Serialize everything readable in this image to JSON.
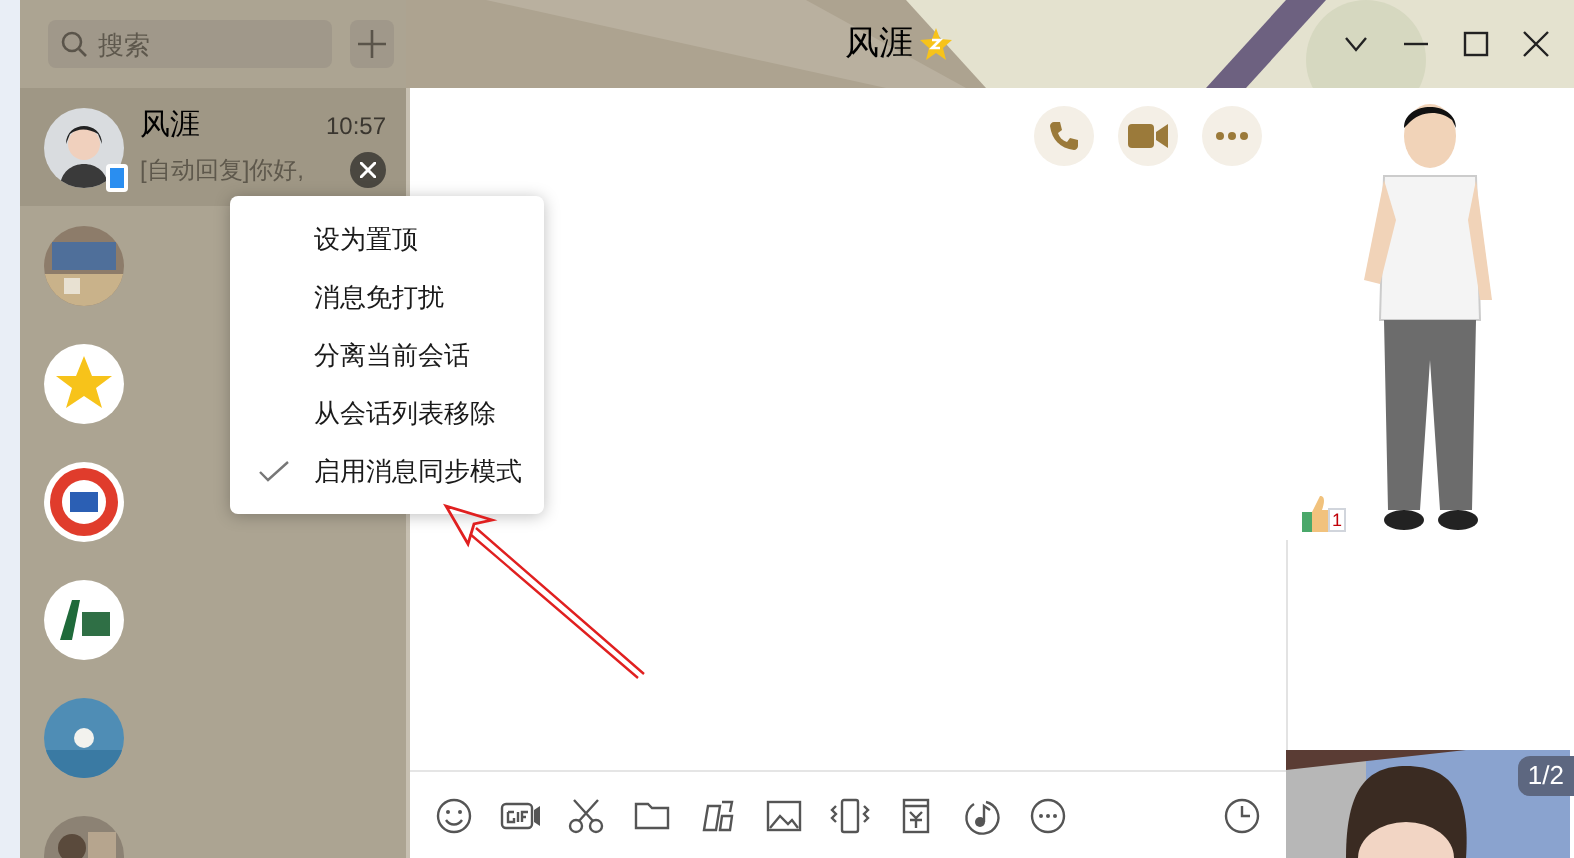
{
  "window": {
    "title": "风涯",
    "search": {
      "placeholder": "搜索"
    }
  },
  "conversations": [
    {
      "name": "风涯",
      "time": "10:57",
      "preview": "[自动回复]你好,",
      "selected": true,
      "mobile_online": true
    },
    {
      "selected": false,
      "mobile_online": false
    },
    {
      "selected": false,
      "mobile_online": false
    },
    {
      "selected": false,
      "mobile_online": false
    },
    {
      "selected": false,
      "mobile_online": false
    },
    {
      "selected": false,
      "mobile_online": false
    },
    {
      "selected": false,
      "mobile_online": false
    }
  ],
  "context_menu": [
    {
      "label": "设为置顶",
      "checked": false
    },
    {
      "label": "消息免打扰",
      "checked": false
    },
    {
      "label": "分离当前会话",
      "checked": false
    },
    {
      "label": "从会话列表移除",
      "checked": false
    },
    {
      "label": "启用消息同步模式",
      "checked": true
    }
  ],
  "side_panel": {
    "like_count": "1",
    "photo_counter": "1/2"
  }
}
